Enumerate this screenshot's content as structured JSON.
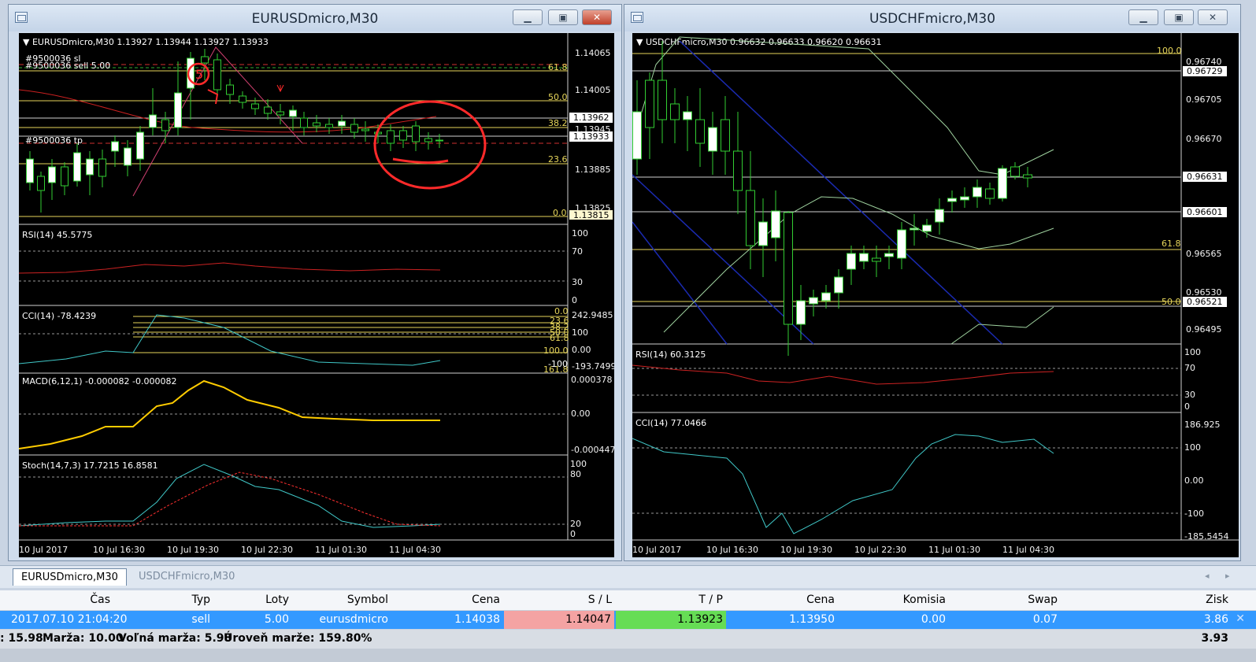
{
  "left_window": {
    "title": "EURUSDmicro,M30",
    "header": "▼ EURUSDmicro,M30  1.13927 1.13944 1.13927 1.13933",
    "order_label_sl": "#9500036 sl",
    "order_label_sell": "#9500036 sell 5.00",
    "order_label_tp": "#9500036 tp",
    "price_axis": [
      "1.14065",
      "1.14005",
      "1.13945",
      "1.13885",
      "1.13825"
    ],
    "price_boxes": [
      "1.13962",
      "1.13933",
      "1.13815"
    ],
    "fib_levels": [
      "61.8",
      "50.0",
      "38.2",
      "23.6",
      "0.0"
    ],
    "annotation": "5",
    "rsi": {
      "label": "RSI(14) 45.5775",
      "axis": [
        "100",
        "70",
        "30",
        "0"
      ]
    },
    "cci": {
      "label": "CCI(14) -78.4239",
      "axis": [
        "242.9485",
        "100",
        "0.00",
        "-193.7499"
      ],
      "fib": [
        "0.0",
        "23.6",
        "38.2",
        "50.0",
        "61.8",
        "100.0",
        "161.8"
      ],
      "extra": "-100"
    },
    "macd": {
      "label": "MACD(6,12,1) -0.000082 -0.000082",
      "axis": [
        "0.000378",
        "0.00",
        "-0.000447"
      ]
    },
    "stoch": {
      "label": "Stoch(14,7,3) 17.7215 16.8581",
      "axis": [
        "100",
        "80",
        "20",
        "0"
      ]
    },
    "time_axis": [
      "10 Jul 2017",
      "10 Jul 16:30",
      "10 Jul 19:30",
      "10 Jul 22:30",
      "11 Jul 01:30",
      "11 Jul 04:30"
    ]
  },
  "right_window": {
    "title": "USDCHFmicro,M30",
    "header": "▼ USDCHFmicro,M30  0.96632 0.96633 0.96620 0.96631",
    "price_axis": [
      "0.96740",
      "0.96705",
      "0.96670",
      "0.96635",
      "0.96565",
      "0.96530",
      "0.96495"
    ],
    "price_boxes": [
      "0.96729",
      "0.96631",
      "0.96601",
      "0.96521"
    ],
    "fib_levels": [
      "100.0",
      "61.8",
      "50.0"
    ],
    "rsi": {
      "label": "RSI(14) 60.3125",
      "axis": [
        "100",
        "70",
        "30",
        "0"
      ]
    },
    "cci": {
      "label": "CCI(14) 77.0466",
      "axis": [
        "186.925",
        "100",
        "0.00",
        "-100",
        "-185.5454"
      ]
    },
    "time_axis": [
      "10 Jul 2017",
      "10 Jul 16:30",
      "10 Jul 19:30",
      "10 Jul 22:30",
      "11 Jul 01:30",
      "11 Jul 04:30"
    ]
  },
  "tabs": [
    "EURUSDmicro,M30",
    "USDCHFmicro,M30"
  ],
  "table": {
    "headers": [
      "Čas",
      "Typ",
      "Loty",
      "Symbol",
      "Cena",
      "S / L",
      "T / P",
      "Cena",
      "Komisia",
      "Swap",
      "Zisk"
    ],
    "row": [
      "2017.07.10 21:04:20",
      "sell",
      "5.00",
      "eurusdmicro",
      "1.14038",
      "1.14047",
      "1.13923",
      "1.13950",
      "0.00",
      "0.07",
      "3.86"
    ]
  },
  "status": {
    "balance": ": 15.98",
    "margin": "Marža: 10.00",
    "free_margin": "Voľná marža: 5.98",
    "margin_level": "Úroveň marže: 159.80%",
    "total": "3.93"
  },
  "colors": {
    "bull": "#ffffff",
    "bear": "#000000",
    "wick": "#32cd32",
    "fib": "#e6d55a",
    "rsi": "#cc2222",
    "macd": "#ffcc00",
    "stoch_main": "#40c8c8",
    "stoch_signal": "#ff3030",
    "annotation": "#ff2a2a",
    "sell_row": "#3399ff"
  }
}
